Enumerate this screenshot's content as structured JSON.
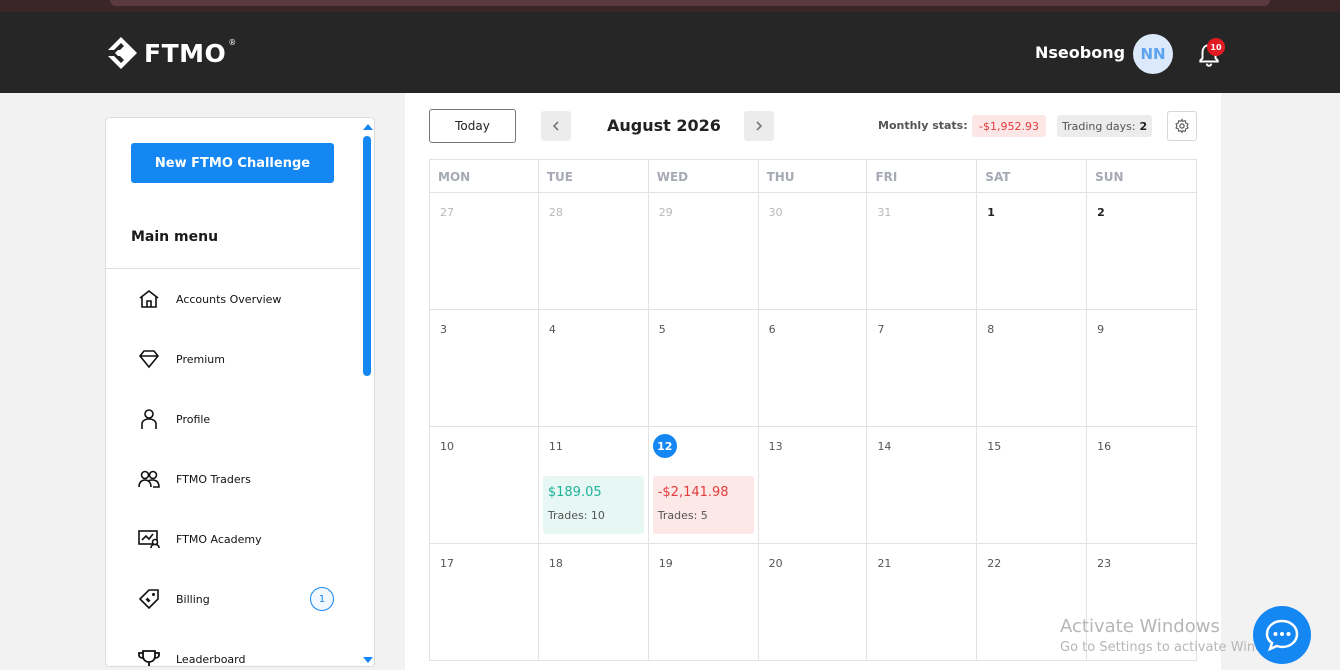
{
  "header": {
    "logo_text": "FTMO",
    "logo_reg": "®",
    "username": "Nseobong",
    "avatar_initials": "NN",
    "notification_count": "10"
  },
  "sidebar": {
    "new_challenge_label": "New FTMO Challenge",
    "menu_title": "Main menu",
    "items": [
      {
        "label": "Accounts Overview",
        "icon": "home-icon"
      },
      {
        "label": "Premium",
        "icon": "diamond-icon"
      },
      {
        "label": "Profile",
        "icon": "user-icon"
      },
      {
        "label": "FTMO Traders",
        "icon": "users-icon"
      },
      {
        "label": "FTMO Academy",
        "icon": "academy-icon"
      },
      {
        "label": "Billing",
        "icon": "tag-icon",
        "badge": "1"
      },
      {
        "label": "Leaderboard",
        "icon": "trophy-icon"
      }
    ]
  },
  "calendar": {
    "today_label": "Today",
    "month_title": "August 2026",
    "stats_label": "Monthly stats:",
    "monthly_pnl": "-$1,952.93",
    "trading_days_label": "Trading days:",
    "trading_days_value": "2",
    "weekdays": [
      "MON",
      "TUE",
      "WED",
      "THU",
      "FRI",
      "SAT",
      "SUN"
    ],
    "weeks": [
      [
        {
          "day": "27",
          "muted": true
        },
        {
          "day": "28",
          "muted": true
        },
        {
          "day": "29",
          "muted": true
        },
        {
          "day": "30",
          "muted": true
        },
        {
          "day": "31",
          "muted": true
        },
        {
          "day": "1"
        },
        {
          "day": "2"
        }
      ],
      [
        {
          "day": "3"
        },
        {
          "day": "4"
        },
        {
          "day": "5"
        },
        {
          "day": "6"
        },
        {
          "day": "7"
        },
        {
          "day": "8"
        },
        {
          "day": "9"
        }
      ],
      [
        {
          "day": "10"
        },
        {
          "day": "11",
          "pnl": "$189.05",
          "trades": "Trades: 10",
          "type": "pos"
        },
        {
          "day": "12",
          "today": true,
          "pnl": "-$2,141.98",
          "trades": "Trades: 5",
          "type": "neg"
        },
        {
          "day": "13"
        },
        {
          "day": "14"
        },
        {
          "day": "15"
        },
        {
          "day": "16"
        }
      ],
      [
        {
          "day": "17"
        },
        {
          "day": "18"
        },
        {
          "day": "19"
        },
        {
          "day": "20"
        },
        {
          "day": "21"
        },
        {
          "day": "22"
        },
        {
          "day": "23"
        }
      ]
    ]
  },
  "watermark": {
    "line1": "Activate Windows",
    "line2": "Go to Settings to activate Windows."
  },
  "colors": {
    "accent": "#1487f2",
    "positive": "#1fb39a",
    "negative": "#e23c3c",
    "header_bg": "#262626"
  }
}
